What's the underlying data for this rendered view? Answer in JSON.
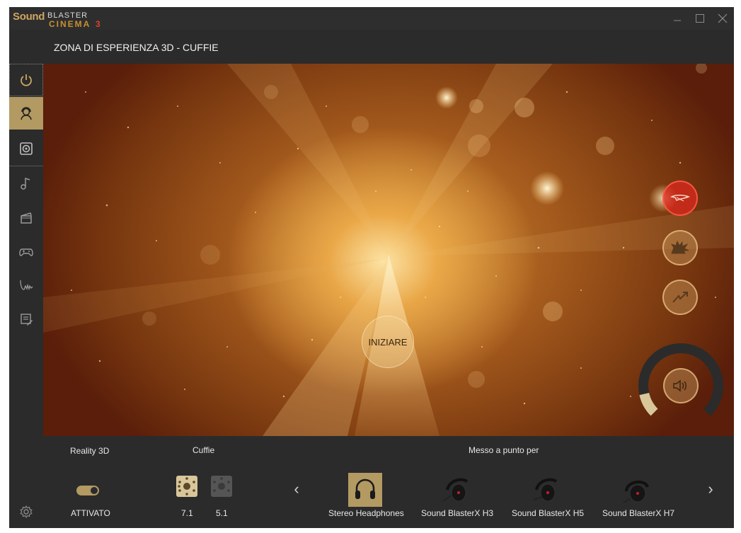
{
  "app": {
    "logo": {
      "sound": "Sound",
      "blaster": "BLASTER",
      "cinema": "CINEMA",
      "cinema_num": "3"
    },
    "window_controls": {
      "minimize": "—",
      "maximize": "☐",
      "close": "✕"
    }
  },
  "header": {
    "title": "ZONA DI ESPERIENZA 3D - CUFFIE"
  },
  "sidebar": {
    "items": [
      {
        "id": "power",
        "icon": "power-icon",
        "active": false
      },
      {
        "id": "headphones-profile",
        "icon": "user-headset-icon",
        "active": true
      },
      {
        "id": "speaker",
        "icon": "speaker-icon",
        "active": false
      },
      {
        "id": "music",
        "icon": "music-note-icon",
        "active": false
      },
      {
        "id": "movie",
        "icon": "clapperboard-icon",
        "active": false
      },
      {
        "id": "game",
        "icon": "gamepad-icon",
        "active": false
      },
      {
        "id": "voice",
        "icon": "voice-wave-icon",
        "active": false
      },
      {
        "id": "profiles",
        "icon": "edit-list-icon",
        "active": false
      }
    ],
    "settings_icon": "gear-icon"
  },
  "scene": {
    "start_label": "INIZIARE",
    "effects": [
      {
        "id": "flight",
        "icon": "plane-icon",
        "active": true
      },
      {
        "id": "explosion",
        "icon": "explosion-icon",
        "active": false
      },
      {
        "id": "lightning",
        "icon": "lightning-icon",
        "active": false
      }
    ],
    "volume_icon": "speaker-volume-icon",
    "volume_level": 0.12
  },
  "bottom": {
    "reality_label": "Reality 3D",
    "reality_state": "ATTIVATO",
    "cuffie_label": "Cuffie",
    "modes": [
      {
        "label": "7.1",
        "active": true
      },
      {
        "label": "5.1",
        "active": false
      }
    ],
    "tuned_for_label": "Messo a punto per",
    "headphones": [
      {
        "label": "Stereo Headphones",
        "active": true
      },
      {
        "label": "Sound BlasterX H3",
        "active": false
      },
      {
        "label": "Sound BlasterX H5",
        "active": false
      },
      {
        "label": "Sound BlasterX H7",
        "active": false
      }
    ],
    "prev_arrow": "‹",
    "next_arrow": "›"
  },
  "colors": {
    "accent": "#b29a62",
    "bg": "#2b2b2b",
    "logo_gold": "#cfa561",
    "effect_active": "#dc281e"
  }
}
